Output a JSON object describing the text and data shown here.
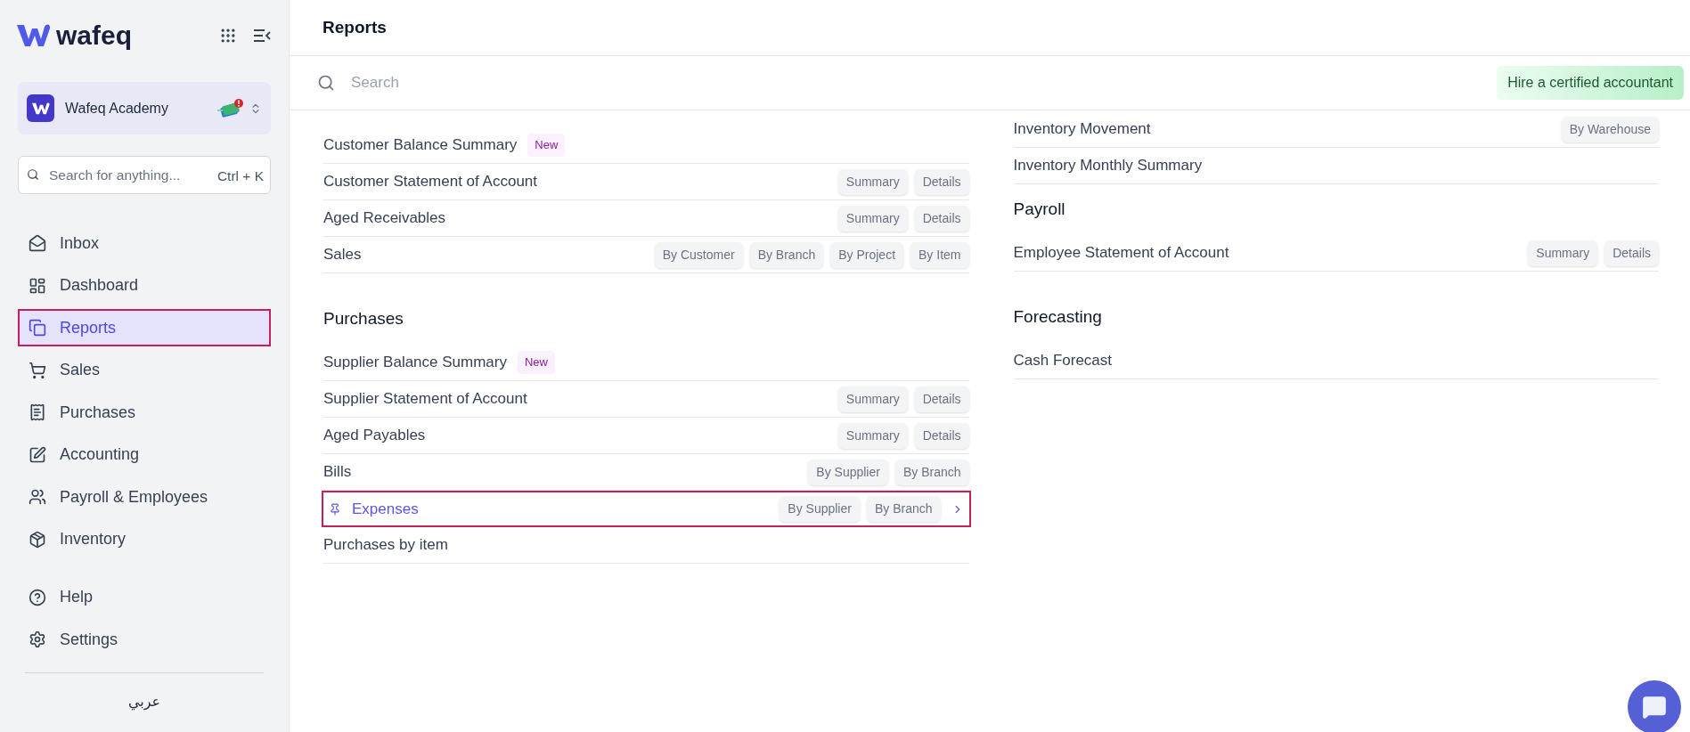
{
  "sidebar": {
    "logo": "wafeq",
    "organization": {
      "name": "Wafeq Academy"
    },
    "search": {
      "placeholder": "Search for anything...",
      "shortcut": "Ctrl + K"
    },
    "nav_items": [
      {
        "label": "Inbox",
        "selected": false,
        "highlighted": false
      },
      {
        "label": "Dashboard",
        "selected": false,
        "highlighted": false
      },
      {
        "label": "Reports",
        "selected": true,
        "highlighted": true
      },
      {
        "label": "Sales",
        "selected": false,
        "highlighted": false
      },
      {
        "label": "Purchases",
        "selected": false,
        "highlighted": false
      },
      {
        "label": "Accounting",
        "selected": false,
        "highlighted": false
      },
      {
        "label": "Payroll & Employees",
        "selected": false,
        "highlighted": false
      },
      {
        "label": "Inventory",
        "selected": false,
        "highlighted": false
      }
    ],
    "bottom_items": [
      {
        "label": "Help"
      },
      {
        "label": "Settings"
      }
    ],
    "language": "عربي"
  },
  "header": {
    "title": "Reports"
  },
  "search": {
    "placeholder": "Search"
  },
  "hire_button": "Hire a certified accountant",
  "columns": [
    {
      "sections": [
        {
          "rows": [
            {
              "label": "Customer Balance Summary",
              "badge": "New",
              "tags": [],
              "pinned": false,
              "highlighted": false
            },
            {
              "label": "Customer Statement of Account",
              "tags": [
                "Summary",
                "Details"
              ],
              "pinned": false,
              "highlighted": false
            },
            {
              "label": "Aged Receivables",
              "tags": [
                "Summary",
                "Details"
              ],
              "pinned": false,
              "highlighted": false
            },
            {
              "label": "Sales",
              "tags": [
                "By Customer",
                "By Branch",
                "By Project",
                "By Item"
              ],
              "pinned": false,
              "highlighted": false
            }
          ]
        },
        {
          "heading": "Purchases",
          "rows": [
            {
              "label": "Supplier Balance Summary",
              "badge": "New",
              "tags": [],
              "pinned": false,
              "highlighted": false
            },
            {
              "label": "Supplier Statement of Account",
              "tags": [
                "Summary",
                "Details"
              ],
              "pinned": false,
              "highlighted": false
            },
            {
              "label": "Aged Payables",
              "tags": [
                "Summary",
                "Details"
              ],
              "pinned": false,
              "highlighted": false
            },
            {
              "label": "Bills",
              "tags": [
                "By Supplier",
                "By Branch"
              ],
              "pinned": false,
              "highlighted": false
            },
            {
              "label": "Expenses",
              "tags": [
                "By Supplier",
                "By Branch"
              ],
              "pinned": true,
              "highlighted": true
            },
            {
              "label": "Purchases by item",
              "tags": [],
              "pinned": false,
              "highlighted": false
            }
          ]
        }
      ]
    },
    {
      "sections": [
        {
          "rows": [
            {
              "label": "Inventory Movement",
              "tags": [
                "By Warehouse"
              ],
              "pinned": false,
              "highlighted": false
            },
            {
              "label": "Inventory Monthly Summary",
              "tags": [],
              "pinned": false,
              "highlighted": false
            }
          ]
        },
        {
          "heading": "Payroll",
          "rows": [
            {
              "label": "Employee Statement of Account",
              "tags": [
                "Summary",
                "Details"
              ],
              "pinned": false,
              "highlighted": false
            }
          ]
        },
        {
          "heading": "Forecasting",
          "rows": [
            {
              "label": "Cash Forecast",
              "tags": [],
              "pinned": false,
              "highlighted": false
            }
          ]
        }
      ]
    }
  ]
}
